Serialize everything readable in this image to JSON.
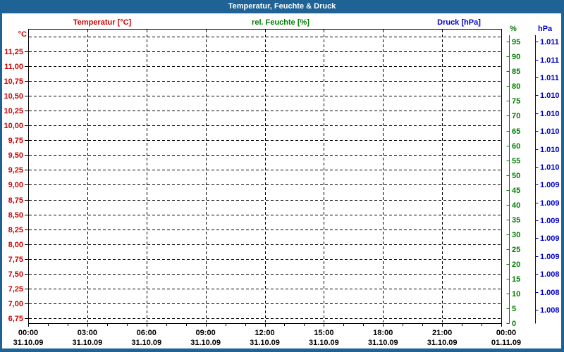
{
  "window": {
    "title": "Temperatur, Feuchte & Druck"
  },
  "theme": {
    "titlebar_bg": "#1F6396",
    "window_border": "#1F6396",
    "background": "#FFFFFF",
    "grid_color": "#000000",
    "temperature_color": "#CC0000",
    "humidity_color": "#007B00",
    "pressure_label_color": "#0000CC",
    "pressure_line_color": "#00008B",
    "x_label_color": "#000000"
  },
  "chart_data": {
    "type": "line",
    "title": "Temperatur, Feuchte & Druck",
    "note": "empty plot area - no data curves drawn, only axes and dashed grid",
    "grid": "dashed black, horizontal lines every 0.25 °C, vertical lines every 3 h",
    "series": [
      {
        "name": "Temperatur [°C]",
        "axis": "left-temperature",
        "color": "#CC0000",
        "values": []
      },
      {
        "name": "rel. Feuchte [%]",
        "axis": "right-humidity",
        "color": "#007B00",
        "values": []
      },
      {
        "name": "Druck [hPa]",
        "axis": "right-pressure",
        "color": "#0000CC",
        "values": []
      }
    ],
    "x_axis": {
      "times": [
        "00:00",
        "03:00",
        "06:00",
        "09:00",
        "12:00",
        "15:00",
        "18:00",
        "21:00",
        "00:00"
      ],
      "dates": [
        "31.10.09",
        "31.10.09",
        "31.10.09",
        "31.10.09",
        "31.10.09",
        "31.10.09",
        "31.10.09",
        "31.10.09",
        "01.11.09"
      ],
      "minor_tick_interval": "1 hour",
      "major_tick_interval": "3 hours"
    },
    "y_axis_temperature": {
      "unit": "°C",
      "labels": [
        "11,25",
        "11,00",
        "10,75",
        "10,50",
        "10,25",
        "10,00",
        "9,75",
        "9,50",
        "9,25",
        "9,00",
        "8,75",
        "8,50",
        "8,25",
        "8,00",
        "7,75",
        "7,50",
        "7,25",
        "7,00",
        "6,75"
      ],
      "min": 6.75,
      "max": 11.25,
      "step": 0.25,
      "extra_unlabeled_top_gridline": true
    },
    "y_axis_humidity": {
      "unit": "%",
      "labels": [
        "95",
        "90",
        "85",
        "80",
        "75",
        "70",
        "65",
        "60",
        "55",
        "50",
        "45",
        "40",
        "35",
        "30",
        "25",
        "20",
        "15",
        "10",
        "5",
        "0"
      ],
      "min": 0,
      "max": 95,
      "step": 5
    },
    "y_axis_pressure": {
      "unit": "hPa",
      "labels": [
        "1.011",
        "1.011",
        "1.011",
        "1.010",
        "1.010",
        "1.010",
        "1.010",
        "1.010",
        "1.009",
        "1.009",
        "1.009",
        "1.009",
        "1.009",
        "1.008",
        "1.008",
        "1.008"
      ]
    }
  }
}
